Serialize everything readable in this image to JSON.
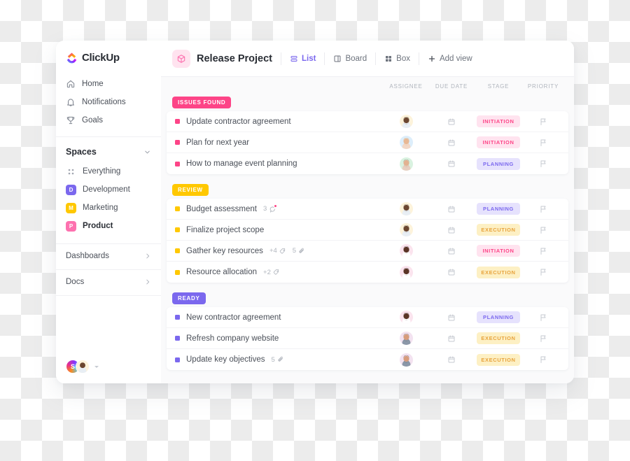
{
  "brand": {
    "name": "ClickUp",
    "logo_icon": "clickup-logo-icon"
  },
  "sidebar": {
    "nav": [
      {
        "label": "Home",
        "icon": "home-icon"
      },
      {
        "label": "Notifications",
        "icon": "bell-icon"
      },
      {
        "label": "Goals",
        "icon": "trophy-icon"
      }
    ],
    "spaces": {
      "title": "Spaces",
      "collapse_icon": "chevron-down-icon",
      "items": [
        {
          "label": "Everything",
          "icon": "grid-icon",
          "initial": "",
          "color": "",
          "active": false
        },
        {
          "label": "Development",
          "icon": "space-badge",
          "initial": "D",
          "color": "#7b68ee",
          "active": false
        },
        {
          "label": "Marketing",
          "icon": "space-badge",
          "initial": "M",
          "color": "#ffc800",
          "active": false
        },
        {
          "label": "Product",
          "icon": "space-badge",
          "initial": "P",
          "color": "#fd71af",
          "active": true
        }
      ]
    },
    "footer_links": [
      {
        "label": "Dashboards",
        "icon": "chevron-right-icon"
      },
      {
        "label": "Docs",
        "icon": "chevron-right-icon"
      }
    ],
    "account": {
      "initial": "S",
      "avatar_icon": "user-avatar",
      "caret_icon": "caret-down-icon"
    }
  },
  "topbar": {
    "project_icon": "box-3d-icon",
    "project_title": "Release Project",
    "views": [
      {
        "label": "List",
        "icon": "list-icon",
        "active": true
      },
      {
        "label": "Board",
        "icon": "board-icon",
        "active": false
      },
      {
        "label": "Box",
        "icon": "box-grid-icon",
        "active": false
      }
    ],
    "add_view": {
      "label": "Add view",
      "icon": "plus-icon"
    }
  },
  "columns": {
    "assignee": "ASSIGNEE",
    "due_date": "DUE DATE",
    "stage": "STAGE",
    "priority": "PRIORITY"
  },
  "colors": {
    "issues_found": "#fd4487",
    "review": "#ffc800",
    "ready": "#7b68ee",
    "initiation_bg": "#ffe3ef",
    "initiation_fg": "#fd4487",
    "planning_bg": "#e6e2fd",
    "planning_fg": "#7b68ee",
    "execution_bg": "#fdf0c4",
    "execution_fg": "#e8a33d",
    "accent": "#7b68ee"
  },
  "groups": [
    {
      "tag": "ISSUES FOUND",
      "tag_color": "#fd4487",
      "dot_color": "#fd4487",
      "tasks": [
        {
          "name": "Update contractor agreement",
          "comments": "",
          "tags": "",
          "attachments": "",
          "assignee_bg": "#fdf3db",
          "assignee_skin": "#6b4630",
          "assignee_hair": "#2b1b12",
          "assignee_shirt": "#e8eef4",
          "due_date_icon": "calendar-icon",
          "stage": "INITIATION",
          "stage_bg": "#ffe3ef",
          "stage_fg": "#fd4487",
          "priority_icon": "flag-icon"
        },
        {
          "name": "Plan for next year",
          "comments": "",
          "tags": "",
          "attachments": "",
          "assignee_bg": "#ddeefb",
          "assignee_skin": "#e8b894",
          "assignee_hair": "#d9a45c",
          "assignee_shirt": "#f2d7c6",
          "due_date_icon": "calendar-icon",
          "stage": "INITIATION",
          "stage_bg": "#ffe3ef",
          "stage_fg": "#fd4487",
          "priority_icon": "flag-icon"
        },
        {
          "name": "How to manage event planning",
          "comments": "",
          "tags": "",
          "attachments": "",
          "assignee_bg": "#d9f2e0",
          "assignee_skin": "#e2b291",
          "assignee_hair": "#6e5440",
          "assignee_shirt": "#e7cfc0",
          "due_date_icon": "calendar-icon",
          "stage": "PLANNING",
          "stage_bg": "#e6e2fd",
          "stage_fg": "#7b68ee",
          "priority_icon": "flag-icon"
        }
      ]
    },
    {
      "tag": "REVIEW",
      "tag_color": "#ffc800",
      "dot_color": "#ffc800",
      "tasks": [
        {
          "name": "Budget assessment",
          "comments": "3",
          "comments_unread": true,
          "tags": "",
          "attachments": "",
          "assignee_bg": "#fdf3db",
          "assignee_skin": "#6b4630",
          "assignee_hair": "#2b1b12",
          "assignee_shirt": "#e8eef4",
          "due_date_icon": "calendar-icon",
          "stage": "PLANNING",
          "stage_bg": "#e6e2fd",
          "stage_fg": "#7b68ee",
          "priority_icon": "flag-icon"
        },
        {
          "name": "Finalize project scope",
          "comments": "",
          "tags": "",
          "attachments": "",
          "assignee_bg": "#fdf3db",
          "assignee_skin": "#6b4630",
          "assignee_hair": "#2b1b12",
          "assignee_shirt": "#e8eef4",
          "due_date_icon": "calendar-icon",
          "stage": "EXECUTION",
          "stage_bg": "#fdf0c4",
          "stage_fg": "#e8a33d",
          "priority_icon": "flag-icon"
        },
        {
          "name": "Gather key resources",
          "comments": "",
          "tags": "+4",
          "attachments": "5",
          "assignee_bg": "#fbe4ee",
          "assignee_skin": "#5a3426",
          "assignee_hair": "#18100c",
          "assignee_shirt": "#ffffff",
          "due_date_icon": "calendar-icon",
          "stage": "INITIATION",
          "stage_bg": "#ffe3ef",
          "stage_fg": "#fd4487",
          "priority_icon": "flag-icon"
        },
        {
          "name": "Resource allocation",
          "comments": "",
          "tags": "+2",
          "attachments": "",
          "assignee_bg": "#fbe4ee",
          "assignee_skin": "#5a3426",
          "assignee_hair": "#18100c",
          "assignee_shirt": "#ffffff",
          "due_date_icon": "calendar-icon",
          "stage": "EXECUTION",
          "stage_bg": "#fdf0c4",
          "stage_fg": "#e8a33d",
          "priority_icon": "flag-icon"
        }
      ]
    },
    {
      "tag": "READY",
      "tag_color": "#7b68ee",
      "dot_color": "#7b68ee",
      "tasks": [
        {
          "name": "New contractor agreement",
          "comments": "",
          "tags": "",
          "attachments": "",
          "assignee_bg": "#fbe4ee",
          "assignee_skin": "#5a3426",
          "assignee_hair": "#18100c",
          "assignee_shirt": "#ffffff",
          "due_date_icon": "calendar-icon",
          "stage": "PLANNING",
          "stage_bg": "#e6e2fd",
          "stage_fg": "#7b68ee",
          "priority_icon": "flag-icon"
        },
        {
          "name": "Refresh company website",
          "comments": "",
          "tags": "",
          "attachments": "",
          "assignee_bg": "#f3e2f0",
          "assignee_skin": "#d79c7c",
          "assignee_hair": "#3b2a20",
          "assignee_shirt": "#8b97a8",
          "due_date_icon": "calendar-icon",
          "stage": "EXECUTION",
          "stage_bg": "#fdf0c4",
          "stage_fg": "#e8a33d",
          "priority_icon": "flag-icon"
        },
        {
          "name": "Update key objectives",
          "comments": "",
          "tags": "",
          "attachments": "5",
          "assignee_bg": "#f3e2f0",
          "assignee_skin": "#d79c7c",
          "assignee_hair": "#3b2a20",
          "assignee_shirt": "#8b97a8",
          "due_date_icon": "calendar-icon",
          "stage": "EXECUTION",
          "stage_bg": "#fdf0c4",
          "stage_fg": "#e8a33d",
          "priority_icon": "flag-icon"
        }
      ]
    }
  ]
}
